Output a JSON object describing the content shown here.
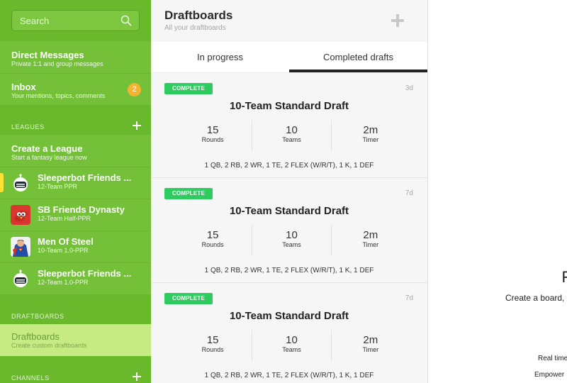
{
  "search": {
    "placeholder": "Search",
    "icon": "search-icon"
  },
  "sidebar": {
    "direct_messages": {
      "title": "Direct Messages",
      "subtitle": "Private 1:1 and group messages"
    },
    "inbox": {
      "title": "Inbox",
      "subtitle": "Your mentions, topics, comments",
      "badge": "2"
    },
    "leagues_header": "LEAGUES",
    "create_league": {
      "title": "Create a League",
      "subtitle": "Start a fantasy league now"
    },
    "leagues": [
      {
        "name": "Sleeperbot Friends ...",
        "subtitle": "12-Team PPR",
        "avatar": "robot-avatar",
        "selected": true
      },
      {
        "name": "SB Friends Dynasty",
        "subtitle": "12-Team Half-PPR",
        "avatar": "red-bird-avatar",
        "selected": false
      },
      {
        "name": "Men Of Steel",
        "subtitle": "10-Team 1.0-PPR",
        "avatar": "superhero-avatar",
        "selected": false
      },
      {
        "name": "Sleeperbot Friends ...",
        "subtitle": "12-Team 1.0-PPR",
        "avatar": "robot-avatar",
        "selected": false
      }
    ],
    "draftboards_header": "DRAFTBOARDS",
    "draftboards_item": {
      "title": "Draftboards",
      "subtitle": "Create custom draftboards"
    },
    "channels_header": "CHANNELS"
  },
  "panel": {
    "title": "Draftboards",
    "subtitle": "All your draftboards",
    "tabs": [
      {
        "label": "In progress",
        "active": false
      },
      {
        "label": "Completed drafts",
        "active": true
      }
    ],
    "drafts": [
      {
        "status": "COMPLETE",
        "age": "3d",
        "title": "10-Team Standard Draft",
        "stats": [
          {
            "value": "15",
            "label": "Rounds"
          },
          {
            "value": "10",
            "label": "Teams"
          },
          {
            "value": "2m",
            "label": "Timer"
          }
        ],
        "settings": "1 QB, 2 RB, 2 WR, 1 TE, 2 FLEX (W/R/T), 1 K, 1 DEF"
      },
      {
        "status": "COMPLETE",
        "age": "7d",
        "title": "10-Team Standard Draft",
        "stats": [
          {
            "value": "15",
            "label": "Rounds"
          },
          {
            "value": "10",
            "label": "Teams"
          },
          {
            "value": "2m",
            "label": "Timer"
          }
        ],
        "settings": "1 QB, 2 RB, 2 WR, 1 TE, 2 FLEX (W/R/T), 1 K, 1 DEF"
      },
      {
        "status": "COMPLETE",
        "age": "7d",
        "title": "10-Team Standard Draft",
        "stats": [
          {
            "value": "15",
            "label": "Rounds"
          },
          {
            "value": "10",
            "label": "Teams"
          },
          {
            "value": "2m",
            "label": "Timer"
          }
        ],
        "settings": "1 QB, 2 RB, 2 WR, 1 TE, 2 FLEX (W/R/T), 1 K, 1 DEF"
      }
    ]
  },
  "right": {
    "heading_fragment": "F",
    "create_text": "Create a board,",
    "realtime_text": "Real time",
    "empower_text": "Empower"
  },
  "colors": {
    "sidebar": "#6ab82c",
    "sidebar_item": "#74c038",
    "sidebar_selected": "#c7ea83",
    "badge": "#f3b432",
    "complete_badge": "#2ecc5f",
    "selected_marker": "#ffe034"
  }
}
